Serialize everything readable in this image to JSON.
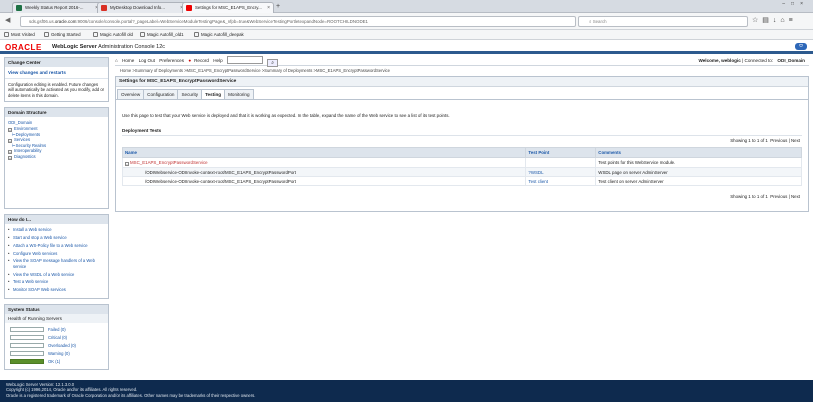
{
  "browser": {
    "tabs": [
      {
        "title": "Weekly Status Report 2016-...",
        "active": false,
        "icon": "excel-icon"
      },
      {
        "title": "MyDesktop Download Info...",
        "active": false,
        "icon": "gmail-icon"
      },
      {
        "title": "Settings for MSC_E1APS_Encry...",
        "active": true,
        "icon": "oracle-icon"
      }
    ],
    "url_prefix": "sds.gsf06.us.",
    "url_host": "oracle.com",
    "url_rest": ":9006/console/console.portal?_pageLabel=WebServiceModuleTestingPage&_nfpb=true&WebServiceTestingPortletexpandNode=ROOTCHILDNODE1",
    "search_placeholder": "Search",
    "bookmarks": [
      "Most Visited",
      "Getting Started",
      "Magic Autofill old",
      "Magic Autofill_old1",
      "Magic Autofill_deepak"
    ]
  },
  "header": {
    "logo": "ORACLE",
    "product_bold": "WebLogic Server",
    "product_rest": "Administration Console 12c"
  },
  "change_center": {
    "title": "Change Center",
    "link": "View changes and restarts",
    "text": "Configuration editing is enabled. Future changes will automatically be activated as you modify, add or delete items in this domain."
  },
  "domain_structure": {
    "title": "Domain Structure",
    "items": [
      {
        "label": "ODI_Domain",
        "indent": 0,
        "toggle": ""
      },
      {
        "label": "Environment",
        "indent": 1,
        "toggle": "+"
      },
      {
        "label": "Deployments",
        "indent": 1,
        "toggle": ""
      },
      {
        "label": "Services",
        "indent": 1,
        "toggle": "+"
      },
      {
        "label": "Security Realms",
        "indent": 1,
        "toggle": ""
      },
      {
        "label": "Interoperability",
        "indent": 1,
        "toggle": "+"
      },
      {
        "label": "Diagnostics",
        "indent": 1,
        "toggle": "+"
      }
    ]
  },
  "how_do_i": {
    "title": "How do I...",
    "items": [
      "Install a Web service",
      "Start and stop a Web service",
      "Attach a WS-Policy file to a Web service",
      "Configure Web services",
      "View the SOAP message handlers of a Web service",
      "View the WSDL of a Web service",
      "Test a Web service",
      "Monitor SOAP Web services"
    ]
  },
  "system_status": {
    "title": "System Status",
    "subtitle": "Health of Running Servers",
    "rows": [
      {
        "label": "Failed (0)",
        "ok": false
      },
      {
        "label": "Critical (0)",
        "ok": false
      },
      {
        "label": "Overloaded (0)",
        "ok": false
      },
      {
        "label": "Warning (0)",
        "ok": false
      },
      {
        "label": "OK (1)",
        "ok": true
      }
    ]
  },
  "toolbar": {
    "home": "Home",
    "logout": "Log Out",
    "preferences": "Preferences",
    "record": "Record",
    "help": "Help",
    "welcome_label": "Welcome, weblogic",
    "connected": "Connected to:",
    "domain": "ODI_Domain"
  },
  "breadcrumb": "Home >Summary of Deployments >MSC_E1APS_EncryptPasswordService >Summary of Deployments >MSC_E1APS_EncryptPasswordService",
  "settings": {
    "title": "Settings for MSC_E1APS_EncryptPasswordService",
    "tabs": [
      "Overview",
      "Configuration",
      "Security",
      "Testing",
      "Monitoring"
    ],
    "active_tab": "Testing",
    "description": "Use this page to test that your Web service is deployed and that it is working as expected. In the table, expand the name of the Web service to see a list of its test points.",
    "section_title": "Deployment Tests",
    "pager": {
      "showing": "Showing 1 to 1 of 1",
      "previous": "Previous",
      "next": "Next"
    },
    "columns": [
      "Name",
      "Test Point",
      "Comments"
    ],
    "rows": [
      {
        "name": "MSC_E1APS_EncryptPasswordService",
        "test_point": "",
        "comment": "Test points for this WebService module.",
        "expander": true
      },
      {
        "name": "/ODIWebservice-ODIInvoke-context-root/MSC_E1APS_EncryptPasswordPort",
        "test_point": "?WSDL",
        "comment": "WSDL page on server AdminServer",
        "expander": false
      },
      {
        "name": "/ODIWebservice-ODIInvoke-context-root/MSC_E1APS_EncryptPasswordPort",
        "test_point": "Test client",
        "comment": "Test client on server AdminServer",
        "expander": false
      }
    ]
  },
  "footer": {
    "line1": "WebLogic Server Version: 12.1.3.0.0",
    "line2": "Copyright (c) 1996,2014, Oracle and/or its affiliates. All rights reserved.",
    "line3": "Oracle is a registered trademark of Oracle Corporation and/or its affiliates. Other names may be trademarks of their respective owners."
  }
}
